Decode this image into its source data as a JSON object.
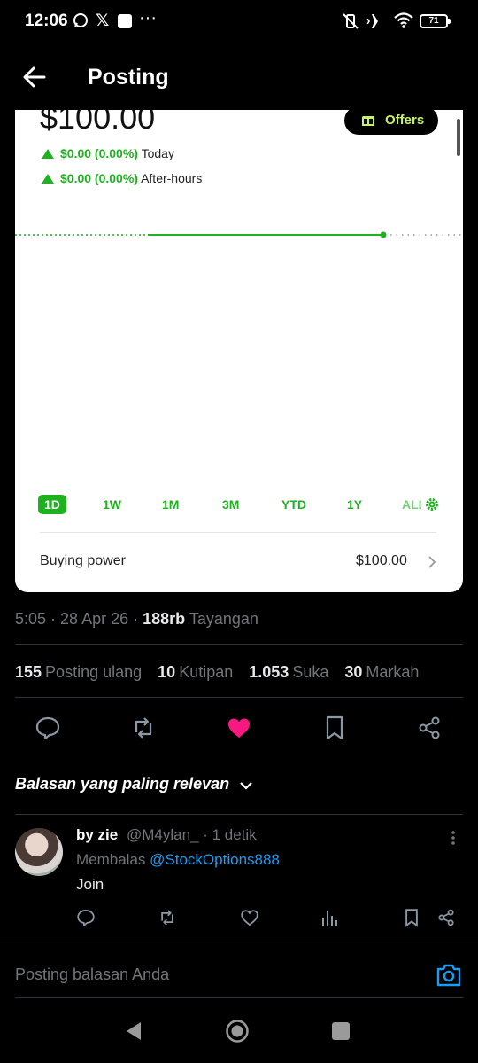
{
  "status_bar": {
    "time": "12:06",
    "battery": "71"
  },
  "header": {
    "title": "Posting"
  },
  "card": {
    "price": "$100.00",
    "offers_label": "Offers",
    "today": {
      "value": "$0.00 (0.00%)",
      "label": "Today"
    },
    "after_hours": {
      "value": "$0.00 (0.00%)",
      "label": "After-hours"
    },
    "ranges": [
      "1D",
      "1W",
      "1M",
      "3M",
      "YTD",
      "1Y",
      "ALL"
    ],
    "active_range": "1D",
    "buying_power_label": "Buying power",
    "buying_power_value": "$100.00",
    "accent_color": "#1fb21f"
  },
  "post_meta": {
    "time": "5:05",
    "date": "28 Apr 26",
    "views": "188rb",
    "views_label": "Tayangan"
  },
  "stats": [
    {
      "count": "155",
      "label": "Posting ulang"
    },
    {
      "count": "10",
      "label": "Kutipan"
    },
    {
      "count": "1.053",
      "label": "Suka"
    },
    {
      "count": "30",
      "label": "Markah"
    }
  ],
  "sort_label": "Balasan yang paling relevan",
  "reply": {
    "name": "by zie",
    "handle": "@M4ylan_ · 1 detik",
    "replying_prefix": "Membalas",
    "replying_to": "@StockOptions888",
    "text": "Join"
  },
  "compose_placeholder": "Posting balasan Anda",
  "like_color": "#f91880",
  "link_color": "#1d9bf0"
}
